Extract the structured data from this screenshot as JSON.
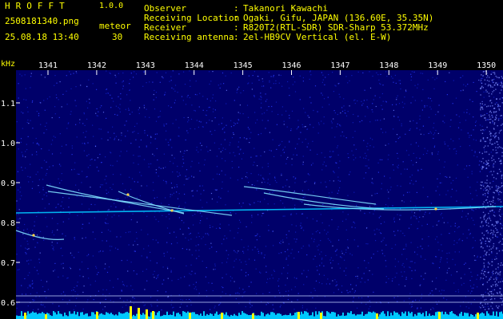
{
  "header": {
    "app_title": "HROFFT",
    "app_version": "1.0.0",
    "file_name": "2508181340.png",
    "timestamp": "25.08.18 13:40",
    "meteor_label": "meteor",
    "meteor_count": "30",
    "info": [
      {
        "label": "Observer",
        "sep": ":",
        "value": "Takanori Kawachi"
      },
      {
        "label": "Receiving Location",
        "sep": ":",
        "value": "Ogaki, Gifu, JAPAN (136.60E, 35.35N)"
      },
      {
        "label": "Receiver",
        "sep": ":",
        "value": "R820T2(RTL-SDR) SDR-Sharp 53.372MHz"
      },
      {
        "label": "Receiving antenna",
        "sep": ":",
        "value": "2el-HB9CV Vertical (el. E-W)"
      }
    ]
  },
  "colors": {
    "background": "#000000",
    "text_yellow": "#ffff00",
    "text_white": "#ffffff",
    "noise_low": "#00007a",
    "noise_high": "#2a3cff",
    "trace": "#7fe0ff",
    "baseline": "#00c8ff",
    "echo_bar": "#ffff00"
  },
  "axis": {
    "unit": "kHz",
    "x_ticks": [
      "1341",
      "1342",
      "1343",
      "1344",
      "1345",
      "1346",
      "1347",
      "1348",
      "1349",
      "1350"
    ],
    "y_ticks": [
      "1.1",
      "1.0",
      "0.9",
      "0.8",
      "0.7",
      "0.6"
    ]
  }
}
